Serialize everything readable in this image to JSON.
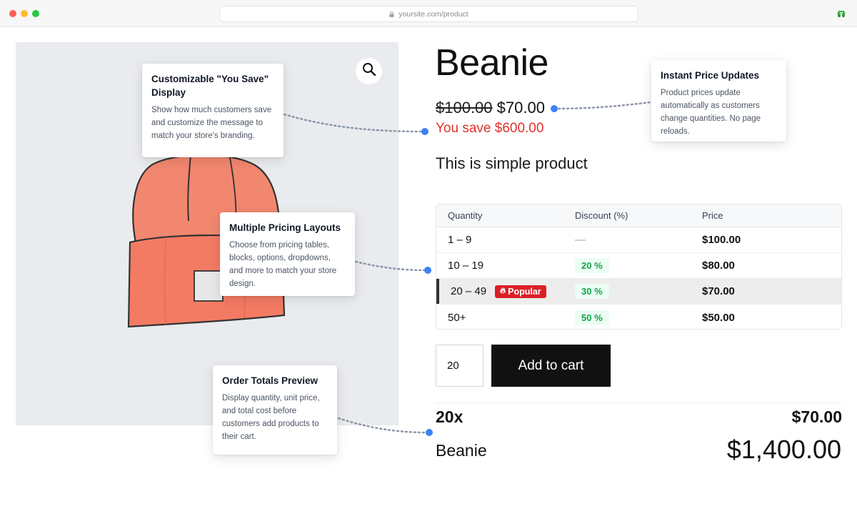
{
  "browser": {
    "url": "yoursite.com/product"
  },
  "product": {
    "title": "Beanie",
    "price_old": "$100.00",
    "price_new": "$70.00",
    "you_save": "You save $600.00",
    "short_description": "This is simple product"
  },
  "pricing_table": {
    "headers": [
      "Quantity",
      "Discount (%)",
      "Price"
    ],
    "rows": [
      {
        "quantity": "1 – 9",
        "discount": "—",
        "price": "$100.00"
      },
      {
        "quantity": "10 – 19",
        "discount": "20 %",
        "price": "$80.00"
      },
      {
        "quantity": "20 – 49",
        "discount": "30 %",
        "price": "$70.00",
        "badge": "Popular"
      },
      {
        "quantity": "50+",
        "discount": "50 %",
        "price": "$50.00"
      }
    ]
  },
  "cart": {
    "quantity": "20",
    "add_to_cart_label": "Add to cart"
  },
  "totals": {
    "quantity_label": "20x",
    "unit_price": "$70.00",
    "product_name": "Beanie",
    "total": "$1,400.00"
  },
  "callouts": {
    "you_save": {
      "title": "Customizable \"You Save\" Display",
      "text": "Show how much customers save and customize the message to match your store's branding."
    },
    "instant_price": {
      "title": "Instant Price Updates",
      "text": "Product prices update automatically as customers change quantities. No page reloads."
    },
    "pricing_layouts": {
      "title": "Multiple Pricing Layouts",
      "text": "Choose from pricing tables, blocks, options, dropdowns, and more to match your store design."
    },
    "order_totals": {
      "title": "Order Totals Preview",
      "text": "Display quantity, unit price, and total cost before customers add products to their cart."
    }
  },
  "colors": {
    "accent_dot": "#3b82f6",
    "save_red": "#e0322b",
    "popular_red": "#dc1f26",
    "discount_green": "#16a34a",
    "button_black": "#111111"
  }
}
